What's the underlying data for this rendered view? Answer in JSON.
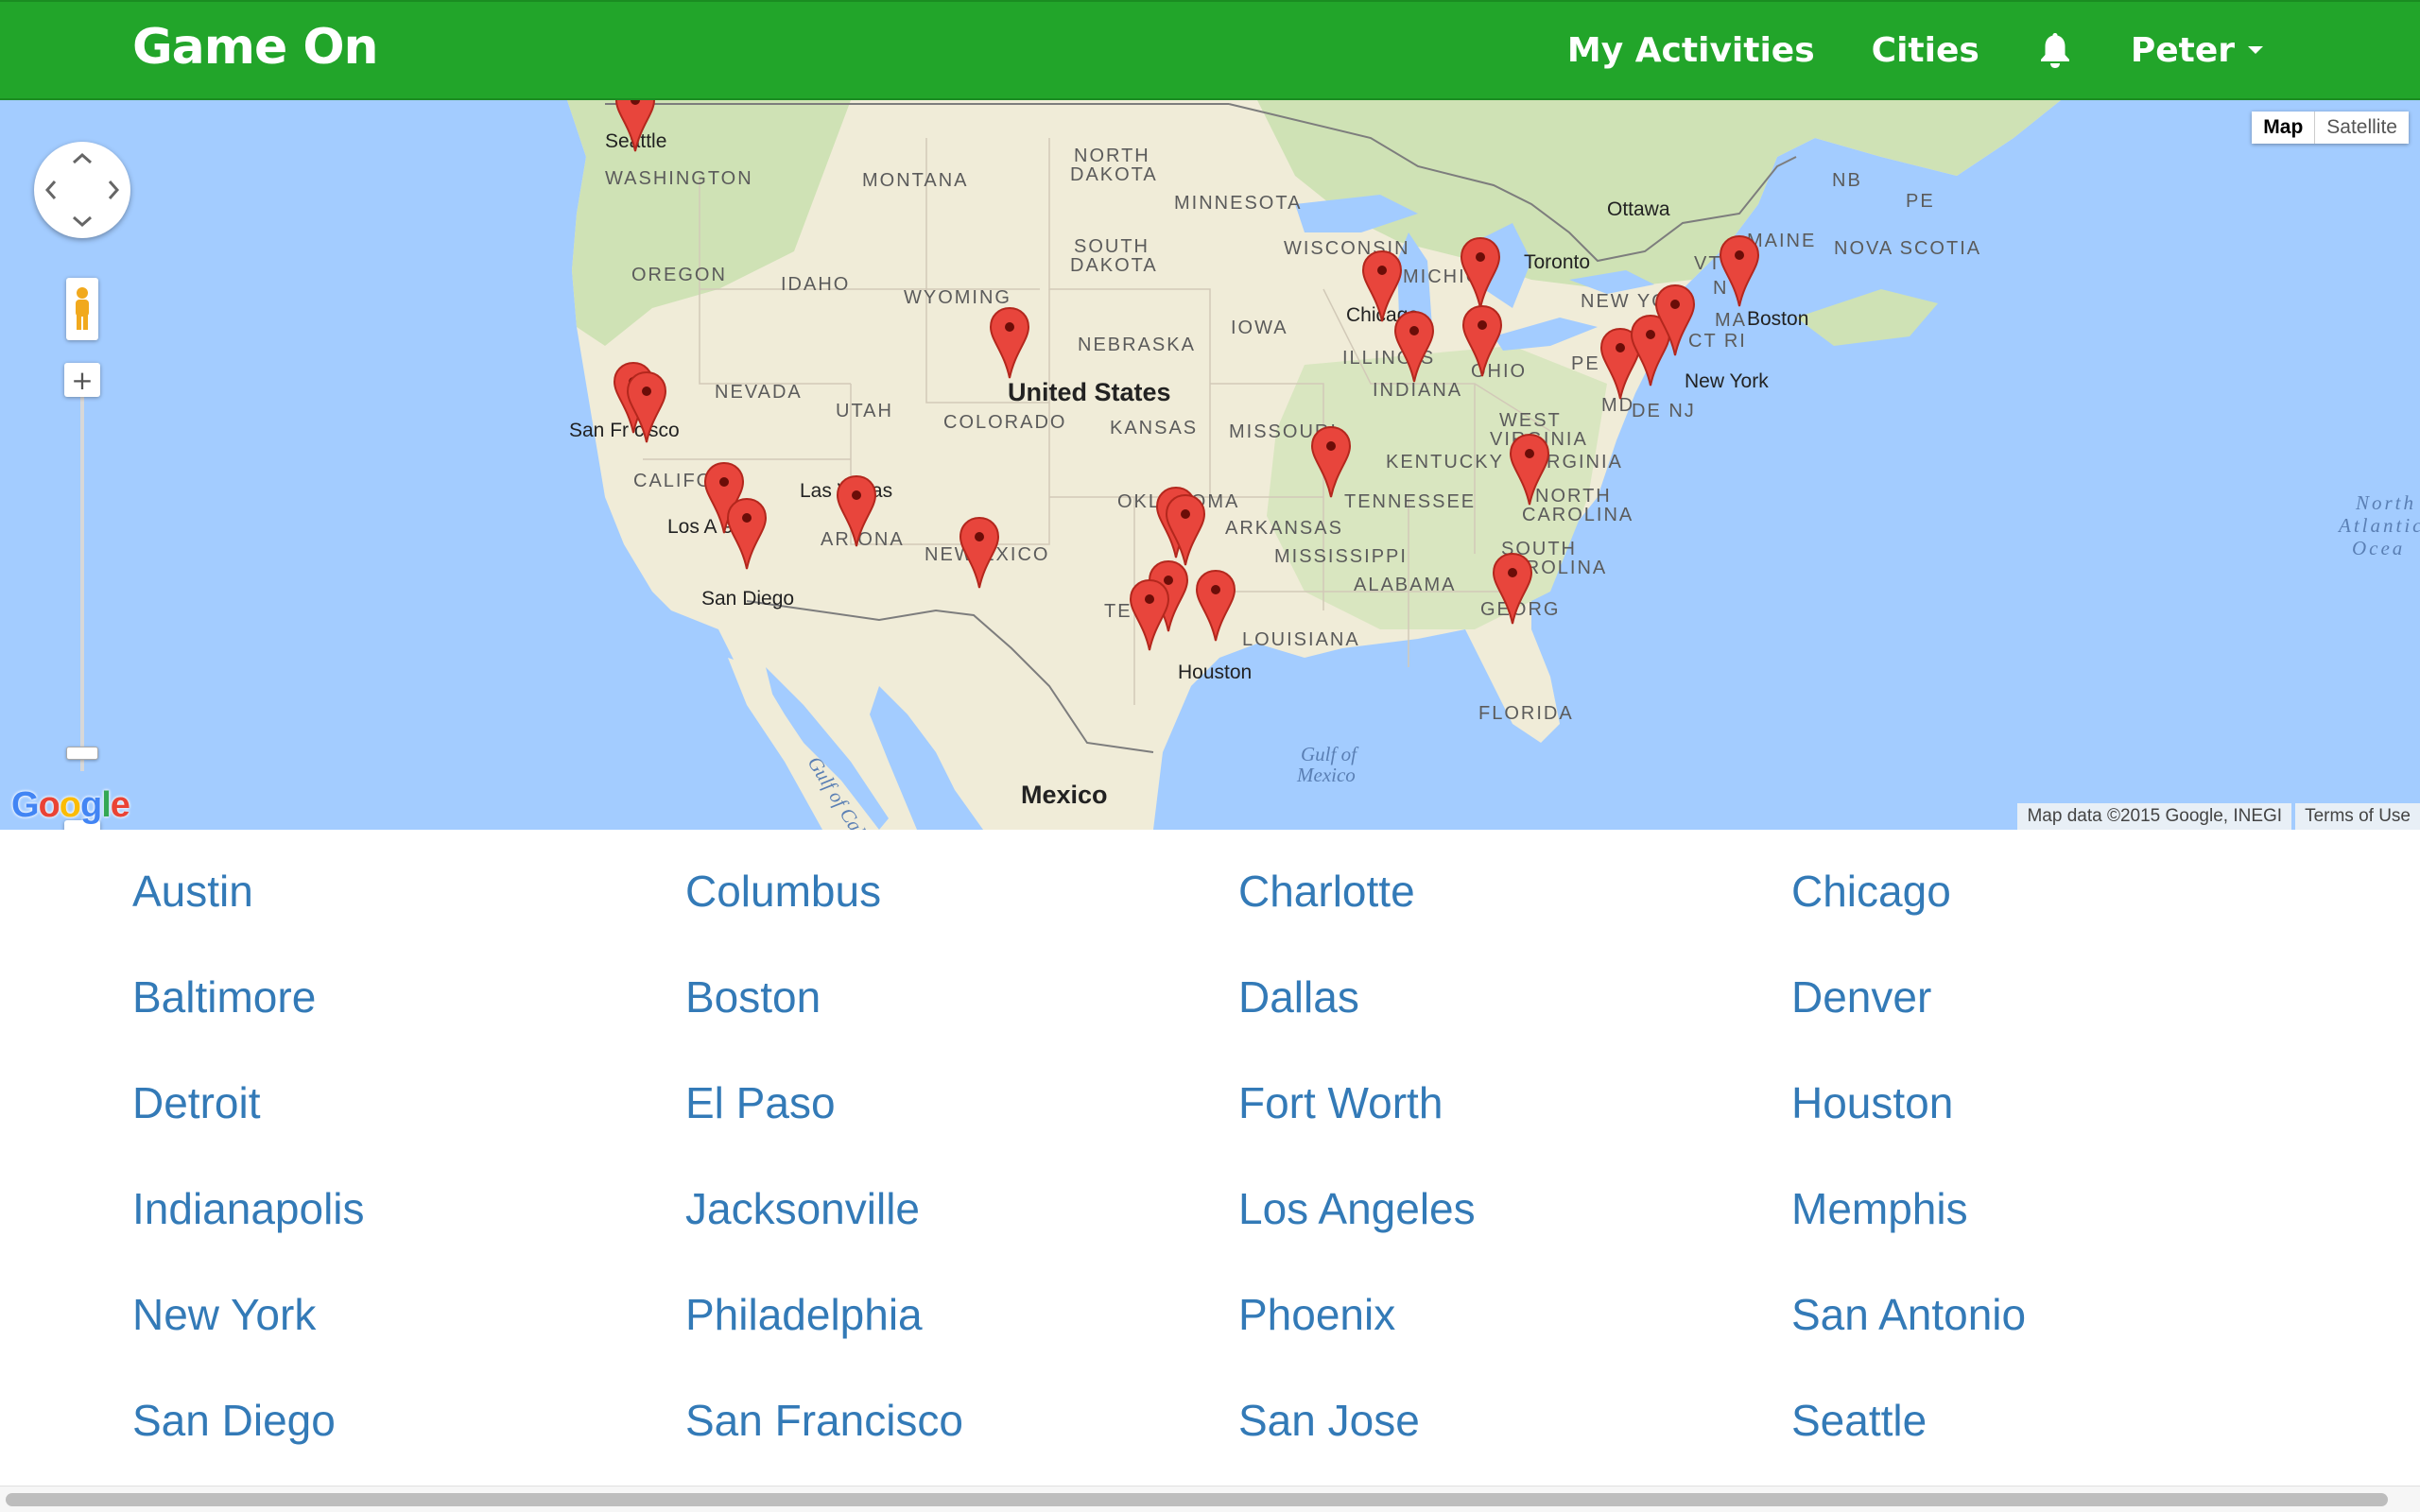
{
  "navbar": {
    "brand": "Game On",
    "links": [
      "My Activities",
      "Cities"
    ],
    "user": "Peter",
    "icons": {
      "notifications": "bell-icon",
      "user_menu": "caret-down-icon"
    },
    "color": "#22a52a"
  },
  "map": {
    "type_controls": {
      "map": "Map",
      "satellite": "Satellite",
      "active": "Map"
    },
    "region_labels": {
      "washington": "WASHINGTON",
      "montana": "MONTANA",
      "north_dakota_1": "NORTH",
      "north_dakota_2": "DAKOTA",
      "minnesota": "MINNESOTA",
      "south_dakota_1": "SOUTH",
      "south_dakota_2": "DAKOTA",
      "oregon": "OREGON",
      "idaho": "IDAHO",
      "wyoming": "WYOMING",
      "wisconsin": "WISCONSIN",
      "michigan": "MICHIG",
      "nebraska": "NEBRASKA",
      "iowa": "IOWA",
      "illinois": "ILLINOIS",
      "nevada": "NEVADA",
      "utah": "UTAH",
      "colorado": "COLORADO",
      "kansas": "KANSAS",
      "missouri": "MISSOURI",
      "indiana": "INDIANA",
      "ohio": "OHIO",
      "california": "CALIFO",
      "oklahoma": "OKLAHOMA",
      "arkansas": "ARKANSAS",
      "arizona": "AR  ONA",
      "new_mexico": "NEW  EXICO",
      "tennessee": "TENNESSEE",
      "kentucky": "KENTUCKY",
      "west_virginia_1": "WEST",
      "west_virginia_2": "VIRGINIA",
      "virginia": "RGINIA",
      "north_carolina_1": "NORTH",
      "north_carolina_2": "CAROLINA",
      "south_carolina_1": "SOUTH",
      "south_carolina_2": "CAROLINA",
      "mississippi": "MISSISSIPPI",
      "alabama": "ALABAMA",
      "georgia": "GEORG",
      "louisiana": "LOUISIANA",
      "texas": "TE",
      "florida": "FLORIDA",
      "new_york_state": "NEW YO",
      "penn": "PE",
      "md": "MD",
      "de_nj": "DE NJ",
      "ma": "MA",
      "ct_ri": "CT RI",
      "vt": "VT",
      "nh": "N",
      "maine": "MAINE",
      "nb": "NB",
      "pe": "PE",
      "nova_scotia": "NOVA SCOTIA"
    },
    "city_labels": {
      "seattle": "Seattle",
      "san_francisco": "San Fr  cisco",
      "los_angeles": "Los A     es",
      "san_diego": "San Diego",
      "las_vegas": "Las Vegas",
      "chicago": "Chicago",
      "toronto": "Toronto",
      "ottawa": "Ottawa",
      "boston": "Boston",
      "new_york": "New York",
      "houston": "Houston"
    },
    "country_labels": {
      "united_states": "United States",
      "mexico": "Mexico"
    },
    "water_labels": {
      "gulf_california": "Gulf of California",
      "gulf_mexico_1": "Gulf of",
      "gulf_mexico_2": "Mexico",
      "atlantic_1": "North",
      "atlantic_2": "Atlantic",
      "atlantic_3": "Ocea"
    },
    "logo": "Google",
    "attribution": {
      "data": "Map data ©2015 Google, INEGI",
      "terms": "Terms of Use"
    },
    "zoom_in": "+",
    "zoom_out": "−",
    "icons": {
      "pan": "pan-arrows-icon",
      "street_view": "pegman-icon",
      "marker": "map-pin-icon"
    }
  },
  "cities": [
    [
      "Austin",
      "Columbus",
      "Charlotte",
      "Chicago"
    ],
    [
      "Baltimore",
      "Boston",
      "Dallas",
      "Denver"
    ],
    [
      "Detroit",
      "El Paso",
      "Fort Worth",
      "Houston"
    ],
    [
      "Indianapolis",
      "Jacksonville",
      "Los Angeles",
      "Memphis"
    ],
    [
      "New York",
      "Philadelphia",
      "Phoenix",
      "San Antonio"
    ],
    [
      "San Diego",
      "San Francisco",
      "San Jose",
      "Seattle"
    ]
  ],
  "colors": {
    "link": "#337ab7",
    "marker": "#e8453c",
    "water": "#a3ccff",
    "land": "#f0ecd8"
  }
}
